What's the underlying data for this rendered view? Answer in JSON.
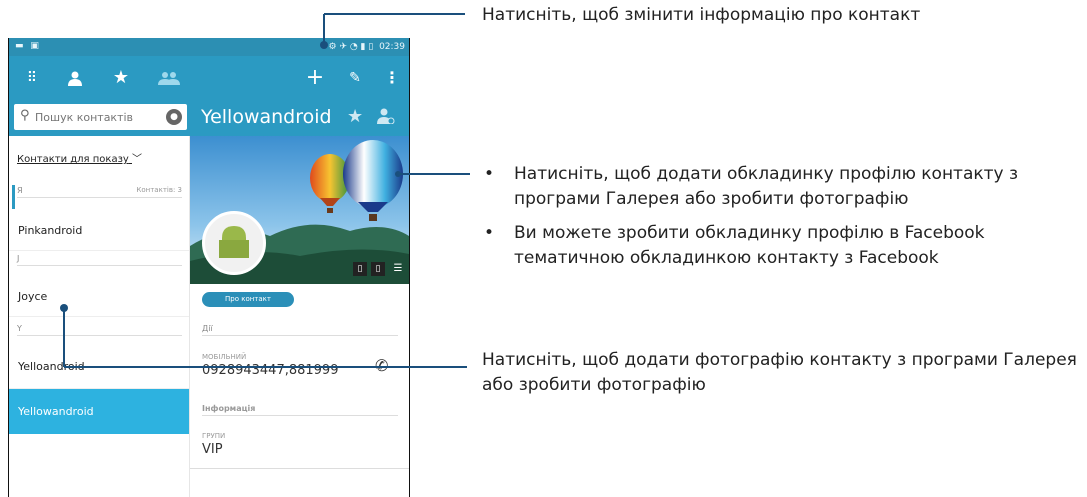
{
  "status_bar": {
    "time": "02:39"
  },
  "search": {
    "placeholder": "Пошук контактів"
  },
  "detail": {
    "name": "Yellowandroid"
  },
  "left_pane": {
    "filter_label": "Контакти для показу",
    "count_label": "Контактів: 3",
    "groups": [
      {
        "letter": "Я"
      },
      {
        "letter": "J"
      },
      {
        "letter": "Y"
      }
    ],
    "contacts": [
      "Pinkandroid",
      "Joyce",
      "Yelloandroid",
      "Yellowandroid"
    ]
  },
  "detail_pane": {
    "about_button": "Про контакт",
    "actions_label": "Дії",
    "mobile_label": "МОБІЛЬНИЙ",
    "mobile_value": "0928943447,881999",
    "info_label": "Інформація",
    "groups_label": "ГРУПИ",
    "groups_value": "VIP"
  },
  "callouts": {
    "edit": "Натисніть, щоб змінити інформацію про контакт",
    "cover_1": "Натисніть, щоб додати обкладинку профілю контакту з програми Галерея або зробити фотографію",
    "cover_2": "Ви можете зробити обкладинку профілю в Facebook тематичною обкладинкою контакту з Facebook",
    "photo": "Натисніть, щоб додати фотографію контакту з програми Галерея або зробити фотографію"
  },
  "colors": {
    "action_bar": "#2b9ac2",
    "selected_row": "#2db2e0"
  },
  "icons": [
    "dialpad-icon",
    "person-icon",
    "star-icon",
    "groups-icon",
    "add-icon",
    "edit-icon",
    "overflow-menu-icon",
    "search-icon",
    "mic-icon",
    "phone-icon"
  ]
}
